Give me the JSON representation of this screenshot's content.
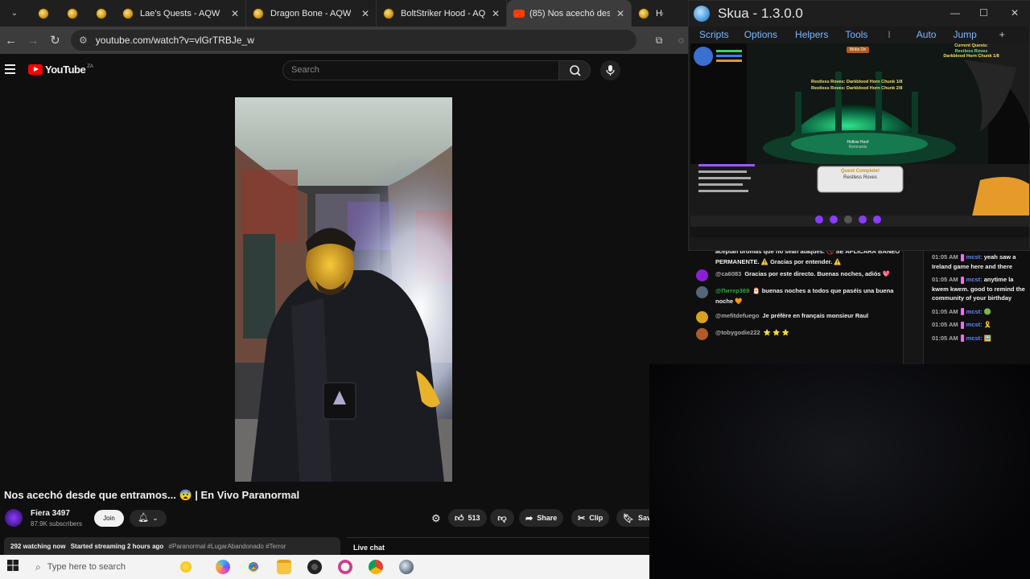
{
  "browser": {
    "tabs": [
      {
        "label": "Lae's Quests - AQW"
      },
      {
        "label": "Dragon Bone - AQW"
      },
      {
        "label": "BoltStriker Hood - AQW"
      },
      {
        "label": "(85) Nos acechó des"
      },
      {
        "label": "Hol"
      }
    ],
    "close_glyph": "✕",
    "url": "youtube.com/watch?v=vlGrTRBJe_w"
  },
  "youtube": {
    "logo_text": "YouTube",
    "country": "ZA",
    "search_placeholder": "Search"
  },
  "video": {
    "title": "Nos acechó desde que entramos... 😨 | En Vivo Paranormal",
    "channel": "Fiera 3497",
    "subscribers": "87.9K subscribers",
    "join_label": "Join",
    "like_count": "513",
    "share_label": "Share",
    "clip_label": "Clip",
    "save_label": "Sav",
    "views": "292 watching now",
    "started": "Started streaming 2 hours ago",
    "hashtags": "#Paranormal #LugarAbandonado #Terror",
    "live_chat_label": "Live chat"
  },
  "taskbar": {
    "search_placeholder": "Type here to search"
  },
  "skua": {
    "title": "Skua - 1.3.0.0",
    "menu": [
      "Scripts",
      "Options",
      "Helpers",
      "Tools",
      "I",
      "Auto",
      "Jump",
      "+"
    ],
    "game": {
      "current_quests_label": "Current Quests:",
      "quest_name": "Restless Roves",
      "quest_progress_1": "Darkblood Horn Chunk 1/8",
      "banner_1": "Restless Roves: Darkblood Horn Chunk 1/8",
      "banner_2": "Restless Roves: Darkblood Horn Chunk 2/8",
      "quest_complete": "Quest Complete!",
      "quest_complete_name": "Restless Roves",
      "npc_label": "Hollow Hoof",
      "npc_sub": "Remnants",
      "map_title": "Mobs On"
    }
  },
  "chat_left": [
    {
      "name": "",
      "text": "aceptan bromas que no sean ataques. 🚫 SE APLICARÁ BANEO PERMANENTE. ⚠️ Gracias por entender. ⚠️",
      "avatar_color": "#0f0f0f"
    },
    {
      "name": "@ca6083",
      "text": "Gracias por este directo. Buenas noches, adiós 💖",
      "avatar_color": "#8b1fd6"
    },
    {
      "name": "@Питер369",
      "text": "🎅 buenas noches a todos que paséis una buena noche 🧡",
      "avatar_color": "#556677",
      "green": true
    },
    {
      "name": "@mefitdefuego",
      "text": "Je préfère en français monsieur Raul",
      "avatar_color": "#d9a21e"
    },
    {
      "name": "@tobygodie222",
      "text": "⭐ ⭐ ⭐",
      "avatar_color": "#b05a2a"
    }
  ],
  "chat_right": [
    {
      "time": "01:05 AM",
      "name": "mcst:",
      "text": "yeah saw a Ireland game here and there"
    },
    {
      "time": "01:05 AM",
      "name": "mcst:",
      "text": "anytime la kwem kwem. good to remind the community of your birthday"
    },
    {
      "time": "01:05 AM",
      "name": "mcst:",
      "text": "🟢"
    },
    {
      "time": "01:05 AM",
      "name": "mcst:",
      "text": "🎗️"
    },
    {
      "time": "01:05 AM",
      "name": "mcst:",
      "text": "🖼️"
    }
  ]
}
